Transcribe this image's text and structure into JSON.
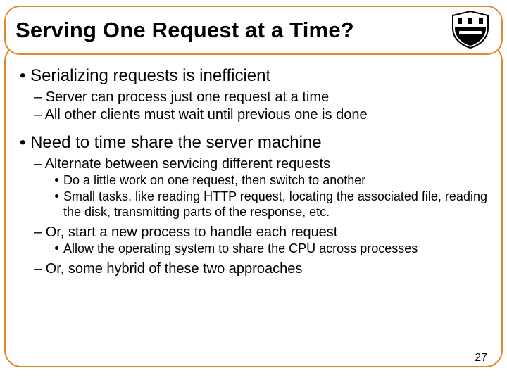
{
  "title": "Serving One Request at a Time?",
  "bullets": {
    "p1": "Serializing requests is inefficient",
    "p1a": "Server can process just one request at a time",
    "p1b": "All other clients must wait until previous one is done",
    "p2": "Need to time share the server machine",
    "p2a": "Alternate between servicing different requests",
    "p2a1": "Do a little work on one request, then switch to another",
    "p2a2": "Small tasks, like reading HTTP request, locating the associated file, reading the disk, transmitting parts of the response, etc.",
    "p2b": "Or, start a new process to handle each request",
    "p2b1": "Allow the operating system to share the CPU across processes",
    "p2c": "Or, some hybrid of these two approaches"
  },
  "page_number": "27",
  "logo_alt": "Princeton shield"
}
